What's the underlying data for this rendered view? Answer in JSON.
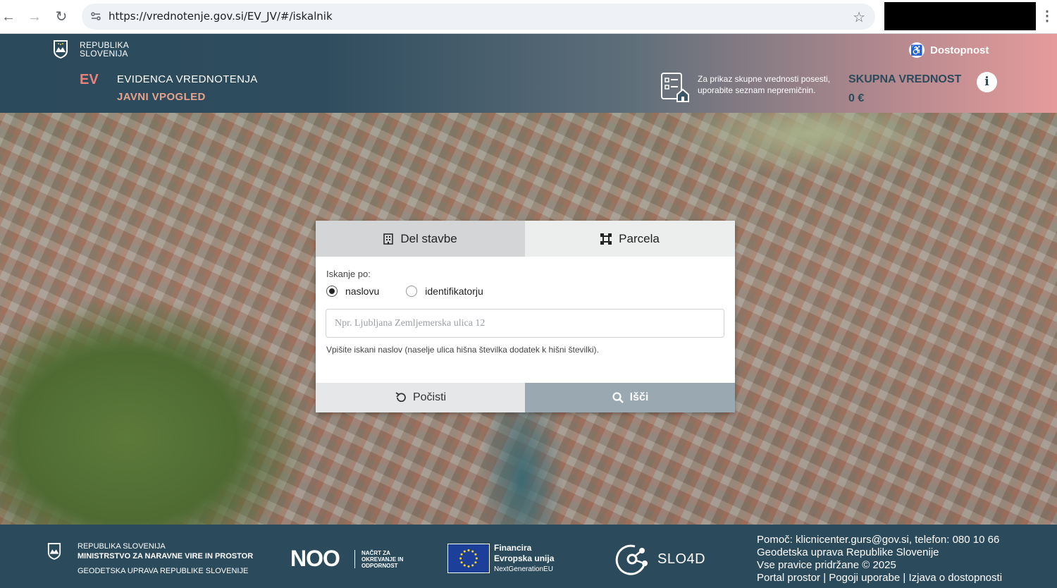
{
  "browser": {
    "url": "https://vrednotenje.gov.si/EV_JV/#/iskalnik"
  },
  "header": {
    "republic_line1": "REPUBLIKA",
    "republic_line2": "SLOVENIJA",
    "accessibility": "Dostopnost",
    "ev": "EV",
    "title": "EVIDENCA VREDNOTENJA",
    "subtitle": "JAVNI VPOGLED",
    "hint": "Za prikaz skupne vrednosti posesti, uporabite seznam nepremičnin.",
    "total_label": "SKUPNA VREDNOST",
    "total_value": "0 €",
    "info_icon": "i"
  },
  "search": {
    "tabs": [
      {
        "label": "Del stavbe",
        "icon": "building-icon"
      },
      {
        "label": "Parcela",
        "icon": "parcel-icon"
      }
    ],
    "search_by_label": "Iskanje po:",
    "options": [
      "naslovu",
      "identifikatorju"
    ],
    "selected_option": "naslovu",
    "placeholder": "Npr. Ljubljana Zemljemerska ulica 12",
    "help": "Vpišite iskani naslov (naselje ulica hišna številka dodatek k hišni številki).",
    "clear_label": "Počisti",
    "search_label": "Išči"
  },
  "footer": {
    "rep_line1": "REPUBLIKA SLOVENIJA",
    "rep_line2": "MINISTRSTVO ZA NARAVNE VIRE IN PROSTOR",
    "rep_line3": "GEODETSKA UPRAVA REPUBLIKE SLOVENIJE",
    "noo_logo": "NOO",
    "noo_text": "NAČRT ZA OKREVANJE IN ODPORNOST",
    "eu_line1": "Financira",
    "eu_line2": "Evropska unija",
    "eu_line3": "NextGenerationEU",
    "slo4d": "SLO4D",
    "help_line": "Pomoč: klicnicenter.gurs@gov.si, telefon: 080 10 66",
    "org_line": "Geodetska uprava Republike Slovenije",
    "rights_line": "Vse pravice pridržane © 2025",
    "links": [
      "Portal prostor",
      "Pogoji uporabe",
      "Izjava o dostopnosti"
    ]
  },
  "colors": {
    "header_dark": "#2b4a5c",
    "accent_salmon": "#e8827c",
    "search_button": "#9aa9b1"
  }
}
